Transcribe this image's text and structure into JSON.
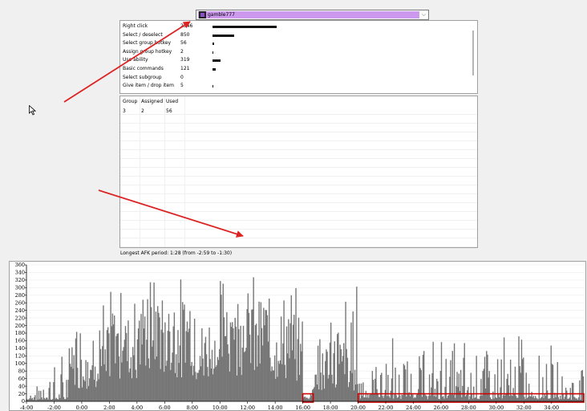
{
  "player": {
    "name": "gamble777",
    "avatar_icon": "player-avatar-icon",
    "name_bg": "#cc99ee"
  },
  "stats": [
    {
      "label": "Right click",
      "count": "2546",
      "value": 2546
    },
    {
      "label": "Select / deselect",
      "count": "850",
      "value": 850
    },
    {
      "label": "Select group hotkey",
      "count": "56",
      "value": 56
    },
    {
      "label": "Assign group hotkey",
      "count": "2",
      "value": 2
    },
    {
      "label": "Use ability",
      "count": "319",
      "value": 319
    },
    {
      "label": "Basic commands",
      "count": "121",
      "value": 121
    },
    {
      "label": "Select subgroup",
      "count": "0",
      "value": 0
    },
    {
      "label": "Give item / drop item",
      "count": "5",
      "value": 5
    }
  ],
  "groups": {
    "headers": [
      "Group",
      "Assigned",
      "Used"
    ],
    "rows": [
      [
        "3",
        "2",
        "56"
      ]
    ]
  },
  "afk_text": "Longest AFK period: 1:28 (from -2:59 to -1:30)",
  "chart_data": {
    "type": "bar",
    "title": "",
    "xlabel": "",
    "ylabel": "",
    "ylim": [
      0,
      360
    ],
    "yticks": [
      0,
      20,
      40,
      60,
      80,
      100,
      120,
      140,
      160,
      180,
      200,
      220,
      240,
      260,
      280,
      300,
      320,
      340,
      360
    ],
    "ytick_labels": [
      "0",
      "20",
      "40",
      "60",
      "80",
      "100",
      "120",
      "140",
      "160",
      "180",
      "200",
      "220",
      "240",
      "260",
      "280",
      "300",
      "320",
      "340",
      "360"
    ],
    "x_range_seconds": [
      -240,
      2180
    ],
    "xticks_seconds": [
      -240,
      -120,
      0,
      120,
      240,
      360,
      480,
      600,
      720,
      840,
      960,
      1080,
      1200,
      1320,
      1440,
      1560,
      1680,
      1800,
      1920,
      2040
    ],
    "xtick_labels": [
      "-4:00",
      "-2:00",
      "0:00",
      "2:00",
      "4:00",
      "6:00",
      "8:00",
      "10:00",
      "12:00",
      "14:00",
      "16:00",
      "18:00",
      "20:00",
      "22:00",
      "24:00",
      "26:00",
      "28:00",
      "30:00",
      "32:00",
      "34:00"
    ],
    "bar_color": "#777777",
    "segments": [
      {
        "from": -240,
        "to": -180,
        "level": 8,
        "peak": 40
      },
      {
        "from": -180,
        "to": -60,
        "level": 10,
        "peak": 125
      },
      {
        "from": -60,
        "to": 120,
        "level": 95,
        "peak": 280
      },
      {
        "from": 120,
        "to": 240,
        "level": 165,
        "peak": 320
      },
      {
        "from": 240,
        "to": 360,
        "level": 190,
        "peak": 340
      },
      {
        "from": 360,
        "to": 480,
        "level": 180,
        "peak": 330
      },
      {
        "from": 480,
        "to": 600,
        "level": 130,
        "peak": 300
      },
      {
        "from": 600,
        "to": 720,
        "level": 190,
        "peak": 330
      },
      {
        "from": 720,
        "to": 840,
        "level": 175,
        "peak": 335
      },
      {
        "from": 840,
        "to": 960,
        "level": 140,
        "peak": 300
      },
      {
        "from": 960,
        "to": 1000,
        "level": 10,
        "peak": 40
      },
      {
        "from": 1000,
        "to": 1080,
        "level": 70,
        "peak": 230
      },
      {
        "from": 1080,
        "to": 1200,
        "level": 80,
        "peak": 330
      },
      {
        "from": 1200,
        "to": 1320,
        "level": 20,
        "peak": 120
      },
      {
        "from": 1320,
        "to": 1440,
        "level": 18,
        "peak": 175
      },
      {
        "from": 1440,
        "to": 1560,
        "level": 16,
        "peak": 160
      },
      {
        "from": 1560,
        "to": 1680,
        "level": 18,
        "peak": 170
      },
      {
        "from": 1680,
        "to": 1800,
        "level": 15,
        "peak": 170
      },
      {
        "from": 1800,
        "to": 1920,
        "level": 18,
        "peak": 200
      },
      {
        "from": 1920,
        "to": 2040,
        "level": 15,
        "peak": 150
      },
      {
        "from": 2040,
        "to": 2180,
        "level": 12,
        "peak": 110
      }
    ],
    "highlights": [
      {
        "from": 960,
        "to": 1005,
        "value": 20
      },
      {
        "from": 1200,
        "to": 2180,
        "value": 20
      }
    ],
    "highlight_color": "#cc0000"
  },
  "annotation_color": "#dd2222"
}
